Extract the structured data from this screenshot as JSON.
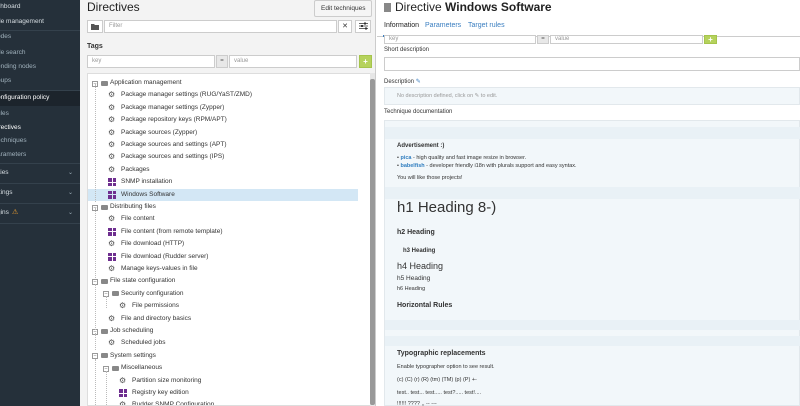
{
  "nav": {
    "items": [
      {
        "label": "shboard",
        "kind": "top"
      },
      {
        "label": "de management",
        "kind": "top"
      },
      {
        "label": "odes",
        "kind": "sub"
      },
      {
        "label": "de search",
        "kind": "sub"
      },
      {
        "label": "ending nodes",
        "kind": "sub"
      },
      {
        "label": "oups",
        "kind": "sub"
      },
      {
        "label": "onfiguration policy",
        "kind": "active"
      },
      {
        "label": "ules",
        "kind": "sub"
      },
      {
        "label": "irectives",
        "kind": "sub-current"
      },
      {
        "label": "echniques",
        "kind": "sub"
      },
      {
        "label": "arameters",
        "kind": "sub"
      },
      {
        "label": "ities",
        "kind": "top"
      },
      {
        "label": "ttings",
        "kind": "top"
      },
      {
        "label": "gins",
        "kind": "top"
      }
    ],
    "chevron": "⌄",
    "warning_glyph": "⚠"
  },
  "tree_panel": {
    "title": "Directives",
    "edit_button": "Edit techniques",
    "filter_placeholder": "Filter",
    "filter_clear": "✕",
    "tags_label": "Tags",
    "tag_key_placeholder": "key",
    "tag_separator": "=",
    "tag_value_placeholder": "value",
    "tag_add": "+"
  },
  "tree": [
    {
      "label": "Application management",
      "type": "category",
      "depth": 0
    },
    {
      "label": "Package manager settings (RUG/YaST/ZMD)",
      "type": "technique",
      "depth": 1
    },
    {
      "label": "Package manager settings (Zypper)",
      "type": "technique",
      "depth": 1
    },
    {
      "label": "Package repository keys (RPM/APT)",
      "type": "technique",
      "depth": 1
    },
    {
      "label": "Package sources (Zypper)",
      "type": "technique",
      "depth": 1
    },
    {
      "label": "Package sources and settings (APT)",
      "type": "technique",
      "depth": 1
    },
    {
      "label": "Package sources and settings (IPS)",
      "type": "technique",
      "depth": 1
    },
    {
      "label": "Packages",
      "type": "technique",
      "depth": 1
    },
    {
      "label": "SNMP installation",
      "type": "windows",
      "depth": 1
    },
    {
      "label": "Windows Software",
      "type": "windows",
      "depth": 1,
      "selected": true
    },
    {
      "label": "Distributing files",
      "type": "category",
      "depth": 0
    },
    {
      "label": "File content",
      "type": "technique",
      "depth": 1
    },
    {
      "label": "File content (from remote template)",
      "type": "windows",
      "depth": 1
    },
    {
      "label": "File download (HTTP)",
      "type": "technique",
      "depth": 1
    },
    {
      "label": "File download (Rudder server)",
      "type": "windows",
      "depth": 1
    },
    {
      "label": "Manage keys-values in file",
      "type": "technique",
      "depth": 1
    },
    {
      "label": "File state configuration",
      "type": "category",
      "depth": 0
    },
    {
      "label": "Security configuration",
      "type": "category",
      "depth": 1
    },
    {
      "label": "File permissions",
      "type": "technique",
      "depth": 2
    },
    {
      "label": "File and directory basics",
      "type": "technique",
      "depth": 1
    },
    {
      "label": "Job scheduling",
      "type": "category",
      "depth": 0
    },
    {
      "label": "Scheduled jobs",
      "type": "technique",
      "depth": 1
    },
    {
      "label": "System settings",
      "type": "category",
      "depth": 0
    },
    {
      "label": "Miscellaneous",
      "type": "category",
      "depth": 1
    },
    {
      "label": "Partition size monitoring",
      "type": "technique",
      "depth": 2
    },
    {
      "label": "Registry key edition",
      "type": "windows",
      "depth": 2
    },
    {
      "label": "Rudder SNMP Configuration",
      "type": "technique",
      "depth": 2
    }
  ],
  "detail": {
    "title_prefix": "Directive",
    "title_name": "Windows Software",
    "tabs": [
      "Information",
      "Parameters",
      "Target rules"
    ],
    "tag_key_placeholder": "key",
    "tag_separator": "=",
    "tag_value_placeholder": "value",
    "short_description_label": "Short description",
    "description_label": "Description",
    "description_edit_glyph": "✎",
    "description_hint": "No description defined, click on ✎ to edit.",
    "doc_label": "Technique documentation",
    "doc": {
      "advert_title": "Advertisement :)",
      "bullet1_link": "pica",
      "bullet1_rest": " - high quality and fast image resize in browser.",
      "bullet2_link": "babelfish",
      "bullet2_rest": " - developer friendly i18n with plurals support and easy syntax.",
      "like_line": "You will like those projects!",
      "h1": "h1 Heading 8-)",
      "h2": "h2 Heading",
      "h3": "h3 Heading",
      "h4": "h4 Heading",
      "h5": "h5 Heading",
      "h6": "h6 Heading",
      "hr_title": "Horizontal Rules",
      "typo_title": "Typographic replacements",
      "typo_enable": "Enable typographer option to see result.",
      "typo_line1": "(c) (C) (r) (R) (tm) (TM) (p) (P) +-",
      "typo_line2": "test.. test... test..... test?..... test!....",
      "typo_line3": "!!!!!! ???? ,, -- ---"
    }
  }
}
